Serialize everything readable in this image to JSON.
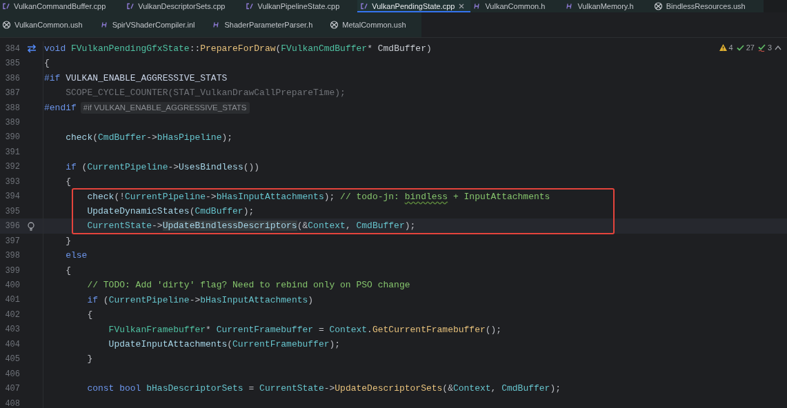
{
  "tabs_row_1": [
    {
      "label": "VulkanCommandBuffer.cpp",
      "kind": "cpp",
      "selected": false,
      "closable": false
    },
    {
      "label": "VulkanDescriptorSets.cpp",
      "kind": "cpp",
      "selected": false,
      "closable": false
    },
    {
      "label": "VulkanPipelineState.cpp",
      "kind": "cpp",
      "selected": false,
      "closable": false
    },
    {
      "label": "VulkanPendingState.cpp",
      "kind": "cpp",
      "selected": true,
      "closable": true
    },
    {
      "label": "VulkanCommon.h",
      "kind": "h",
      "selected": false,
      "closable": false
    },
    {
      "label": "VulkanMemory.h",
      "kind": "h",
      "selected": false,
      "closable": false
    },
    {
      "label": "BindlessResources.ush",
      "kind": "ush",
      "selected": false,
      "closable": false
    }
  ],
  "tabs_row_2": [
    {
      "label": "VulkanCommon.ush",
      "kind": "ush",
      "selected": false,
      "closable": false
    },
    {
      "label": "SpirVShaderCompiler.inl",
      "kind": "h",
      "selected": false,
      "closable": false
    },
    {
      "label": "ShaderParameterParser.h",
      "kind": "h",
      "selected": false,
      "closable": false
    },
    {
      "label": "MetalCommon.ush",
      "kind": "ush",
      "selected": false,
      "closable": false
    }
  ],
  "inspections": [
    {
      "kind": "warning",
      "count": "4"
    },
    {
      "kind": "ok",
      "count": "27"
    },
    {
      "kind": "typo",
      "count": "3"
    }
  ],
  "lines": [
    {
      "number": "384",
      "gutter_icon": {
        "kind": "swap"
      },
      "tokens": [
        {
          "kind": "kw",
          "text": "void "
        },
        {
          "kind": "type",
          "text": "FVulkanPendingGfxState"
        },
        {
          "kind": "plain",
          "text": "::"
        },
        {
          "kind": "method",
          "text": "PrepareForDraw"
        },
        {
          "kind": "plain",
          "text": "("
        },
        {
          "kind": "type",
          "text": "FVulkanCmdBuffer"
        },
        {
          "kind": "plain",
          "text": "* "
        },
        {
          "kind": "param",
          "text": "CmdBuffer"
        },
        {
          "kind": "plain",
          "text": ")"
        }
      ]
    },
    {
      "number": "385",
      "tokens": [
        {
          "kind": "plain",
          "text": "{"
        }
      ]
    },
    {
      "number": "386",
      "tokens": [
        {
          "kind": "directive",
          "text": "#if "
        },
        {
          "kind": "macro",
          "text": "VULKAN_ENABLE_AGGRESSIVE_STATS"
        }
      ]
    },
    {
      "number": "387",
      "tokens": [
        {
          "kind": "inactive",
          "text": "    SCOPE_CYCLE_COUNTER(STAT_VulkanDrawCallPrepareTime);"
        }
      ]
    },
    {
      "number": "388",
      "tokens": [
        {
          "kind": "directive",
          "text": "#endif"
        }
      ],
      "hint": "#if VULKAN_ENABLE_AGGRESSIVE_STATS"
    },
    {
      "number": "389"
    },
    {
      "number": "390",
      "tokens": [
        {
          "kind": "call",
          "text": "    check"
        },
        {
          "kind": "plain",
          "text": "("
        },
        {
          "kind": "var",
          "text": "CmdBuffer"
        },
        {
          "kind": "plain",
          "text": "->"
        },
        {
          "kind": "var",
          "text": "bHasPipeline"
        },
        {
          "kind": "plain",
          "text": ");"
        }
      ]
    },
    {
      "number": "391"
    },
    {
      "number": "392",
      "tokens": [
        {
          "kind": "kw",
          "text": "    if "
        },
        {
          "kind": "plain",
          "text": "("
        },
        {
          "kind": "var",
          "text": "CurrentPipeline"
        },
        {
          "kind": "plain",
          "text": "->"
        },
        {
          "kind": "call",
          "text": "UsesBindless"
        },
        {
          "kind": "plain",
          "text": "())"
        }
      ]
    },
    {
      "number": "393",
      "tokens": [
        {
          "kind": "plain",
          "text": "    {"
        }
      ]
    },
    {
      "number": "394",
      "highlighted": true,
      "tokens": [
        {
          "kind": "call",
          "text": "        check"
        },
        {
          "kind": "plain",
          "text": "(!"
        },
        {
          "kind": "var",
          "text": "CurrentPipeline"
        },
        {
          "kind": "plain",
          "text": "->"
        },
        {
          "kind": "var",
          "text": "bHasInputAttachments"
        },
        {
          "kind": "plain",
          "text": "); "
        },
        {
          "kind": "comment",
          "text": "// todo-jn: "
        },
        {
          "kind": "typo",
          "text": "bindless"
        },
        {
          "kind": "comment",
          "text": " + InputAttachments"
        }
      ]
    },
    {
      "number": "395",
      "highlighted": true,
      "tokens": [
        {
          "kind": "call",
          "text": "        UpdateDynamicStates"
        },
        {
          "kind": "plain",
          "text": "("
        },
        {
          "kind": "var",
          "text": "CmdBuffer"
        },
        {
          "kind": "plain",
          "text": ");"
        }
      ]
    },
    {
      "number": "396",
      "highlighted": true,
      "current": true,
      "gutter_icon": {
        "kind": "bulb"
      },
      "tokens": [
        {
          "kind": "var",
          "text": "        CurrentState"
        },
        {
          "kind": "plain",
          "text": "->"
        },
        {
          "kind": "usage",
          "text": "UpdateBindlessDescriptors"
        },
        {
          "kind": "plain",
          "text": "(&"
        },
        {
          "kind": "var",
          "text": "Context"
        },
        {
          "kind": "plain",
          "text": ", "
        },
        {
          "kind": "var",
          "text": "CmdBuffer"
        },
        {
          "kind": "plain",
          "text": ");"
        }
      ]
    },
    {
      "number": "397",
      "tokens": [
        {
          "kind": "plain",
          "text": "    }"
        }
      ]
    },
    {
      "number": "398",
      "tokens": [
        {
          "kind": "kw",
          "text": "    else"
        }
      ]
    },
    {
      "number": "399",
      "tokens": [
        {
          "kind": "plain",
          "text": "    {"
        }
      ]
    },
    {
      "number": "400",
      "tokens": [
        {
          "kind": "comment",
          "text": "        // TODO: Add 'dirty' flag? Need to rebind only on PSO change"
        }
      ]
    },
    {
      "number": "401",
      "tokens": [
        {
          "kind": "kw",
          "text": "        if "
        },
        {
          "kind": "plain",
          "text": "("
        },
        {
          "kind": "var",
          "text": "CurrentPipeline"
        },
        {
          "kind": "plain",
          "text": "->"
        },
        {
          "kind": "var",
          "text": "bHasInputAttachments"
        },
        {
          "kind": "plain",
          "text": ")"
        }
      ]
    },
    {
      "number": "402",
      "tokens": [
        {
          "kind": "plain",
          "text": "        {"
        }
      ]
    },
    {
      "number": "403",
      "tokens": [
        {
          "kind": "type",
          "text": "            FVulkanFramebuffer"
        },
        {
          "kind": "plain",
          "text": "* "
        },
        {
          "kind": "var",
          "text": "CurrentFramebuffer"
        },
        {
          "kind": "plain",
          "text": " = "
        },
        {
          "kind": "var",
          "text": "Context"
        },
        {
          "kind": "plain",
          "text": "."
        },
        {
          "kind": "method",
          "text": "GetCurrentFramebuffer"
        },
        {
          "kind": "plain",
          "text": "();"
        }
      ]
    },
    {
      "number": "404",
      "tokens": [
        {
          "kind": "call",
          "text": "            UpdateInputAttachments"
        },
        {
          "kind": "plain",
          "text": "("
        },
        {
          "kind": "var",
          "text": "CurrentFramebuffer"
        },
        {
          "kind": "plain",
          "text": ");"
        }
      ]
    },
    {
      "number": "405",
      "tokens": [
        {
          "kind": "plain",
          "text": "        }"
        }
      ]
    },
    {
      "number": "406"
    },
    {
      "number": "407",
      "tokens": [
        {
          "kind": "kw",
          "text": "        const bool "
        },
        {
          "kind": "var",
          "text": "bHasDescriptorSets"
        },
        {
          "kind": "plain",
          "text": " = "
        },
        {
          "kind": "var",
          "text": "CurrentState"
        },
        {
          "kind": "plain",
          "text": "->"
        },
        {
          "kind": "method",
          "text": "UpdateDescriptorSets"
        },
        {
          "kind": "plain",
          "text": "(&"
        },
        {
          "kind": "var",
          "text": "Context"
        },
        {
          "kind": "plain",
          "text": ", "
        },
        {
          "kind": "var",
          "text": "CmdBuffer"
        },
        {
          "kind": "plain",
          "text": ");"
        }
      ]
    },
    {
      "number": "408"
    }
  ]
}
